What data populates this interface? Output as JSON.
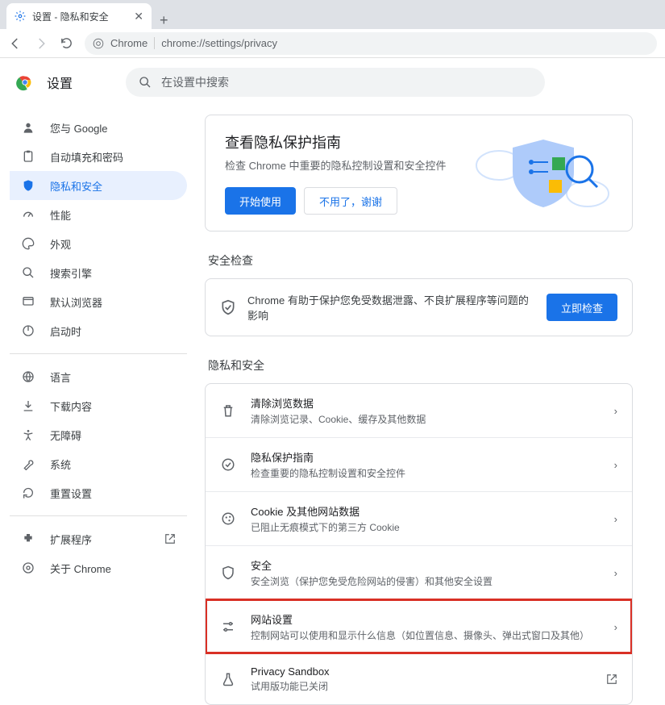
{
  "tab": {
    "title": "设置 - 隐私和安全"
  },
  "omnibox": {
    "label": "Chrome",
    "url": "chrome://settings/privacy"
  },
  "header": {
    "title": "设置"
  },
  "search": {
    "placeholder": "在设置中搜索"
  },
  "sidebar": {
    "items": [
      {
        "label": "您与 Google"
      },
      {
        "label": "自动填充和密码"
      },
      {
        "label": "隐私和安全"
      },
      {
        "label": "性能"
      },
      {
        "label": "外观"
      },
      {
        "label": "搜索引擎"
      },
      {
        "label": "默认浏览器"
      },
      {
        "label": "启动时"
      }
    ],
    "items2": [
      {
        "label": "语言"
      },
      {
        "label": "下载内容"
      },
      {
        "label": "无障碍"
      },
      {
        "label": "系统"
      },
      {
        "label": "重置设置"
      }
    ],
    "items3": [
      {
        "label": "扩展程序"
      },
      {
        "label": "关于 Chrome"
      }
    ]
  },
  "guide": {
    "title": "查看隐私保护指南",
    "subtitle": "检查 Chrome 中重要的隐私控制设置和安全控件",
    "start": "开始使用",
    "dismiss": "不用了，谢谢"
  },
  "safety": {
    "section": "安全检查",
    "text": "Chrome 有助于保护您免受数据泄露、不良扩展程序等问题的影响",
    "button": "立即检查"
  },
  "privacy": {
    "section": "隐私和安全",
    "items": [
      {
        "title": "清除浏览数据",
        "sub": "清除浏览记录、Cookie、缓存及其他数据"
      },
      {
        "title": "隐私保护指南",
        "sub": "检查重要的隐私控制设置和安全控件"
      },
      {
        "title": "Cookie 及其他网站数据",
        "sub": "已阻止无痕模式下的第三方 Cookie"
      },
      {
        "title": "安全",
        "sub": "安全浏览（保护您免受危险网站的侵害）和其他安全设置"
      },
      {
        "title": "网站设置",
        "sub": "控制网站可以使用和显示什么信息（如位置信息、摄像头、弹出式窗口及其他）"
      },
      {
        "title": "Privacy Sandbox",
        "sub": "试用版功能已关闭"
      }
    ]
  }
}
